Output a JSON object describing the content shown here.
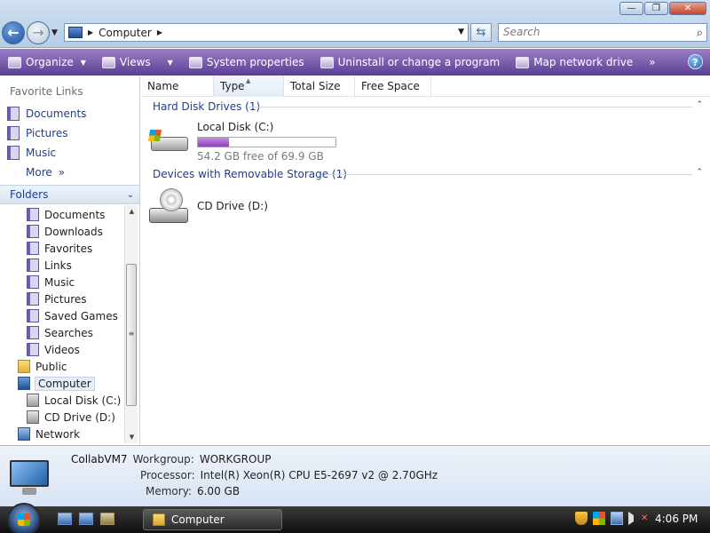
{
  "window": {
    "buttons": {
      "minimize": "—",
      "maximize": "❐",
      "close": "✕"
    }
  },
  "address_bar": {
    "path": "Computer",
    "search_placeholder": "Search"
  },
  "toolbar": {
    "items": [
      {
        "label": "Organize",
        "has_menu": true
      },
      {
        "label": "Views",
        "has_menu": true
      },
      {
        "label": "System properties"
      },
      {
        "label": "Uninstall or change a program"
      },
      {
        "label": "Map network drive"
      }
    ],
    "overflow": "»",
    "help": "?"
  },
  "favorites": {
    "header": "Favorite Links",
    "items": [
      "Documents",
      "Pictures",
      "Music"
    ],
    "more": "More",
    "more_chevron": "»"
  },
  "folders": {
    "label": "Folders",
    "tree": [
      {
        "label": "Documents",
        "icon": "documents-icon"
      },
      {
        "label": "Downloads",
        "icon": "downloads-icon"
      },
      {
        "label": "Favorites",
        "icon": "favorites-icon"
      },
      {
        "label": "Links",
        "icon": "links-icon"
      },
      {
        "label": "Music",
        "icon": "music-icon"
      },
      {
        "label": "Pictures",
        "icon": "pictures-icon"
      },
      {
        "label": "Saved Games",
        "icon": "saved-games-icon"
      },
      {
        "label": "Searches",
        "icon": "searches-icon"
      },
      {
        "label": "Videos",
        "icon": "videos-icon"
      },
      {
        "label": "Public",
        "icon": "folder-icon"
      },
      {
        "label": "Computer",
        "icon": "computer-icon",
        "selected": true
      },
      {
        "label": "Local Disk (C:)",
        "icon": "hard-disk-icon"
      },
      {
        "label": "CD Drive (D:)",
        "icon": "cd-drive-icon"
      },
      {
        "label": "Network",
        "icon": "network-icon"
      }
    ]
  },
  "columns": [
    "Name",
    "Type",
    "Total Size",
    "Free Space"
  ],
  "groups": {
    "hard_disks": {
      "label": "Hard Disk Drives (1)",
      "drive": {
        "name": "Local Disk (C:)",
        "free_text": "54.2 GB free of 69.9 GB",
        "used_fraction": 0.225
      }
    },
    "removable": {
      "label": "Devices with Removable Storage (1)",
      "drive": {
        "name": "CD Drive (D:)"
      }
    }
  },
  "details": {
    "computer_name": "CollabVM7",
    "workgroup_label": "Workgroup:",
    "workgroup": "WORKGROUP",
    "processor_label": "Processor:",
    "processor": "Intel(R) Xeon(R) CPU E5-2697 v2 @ 2.70GHz",
    "memory_label": "Memory:",
    "memory": "6.00 GB"
  },
  "taskbar": {
    "task": "Computer",
    "clock": "4:06 PM"
  }
}
